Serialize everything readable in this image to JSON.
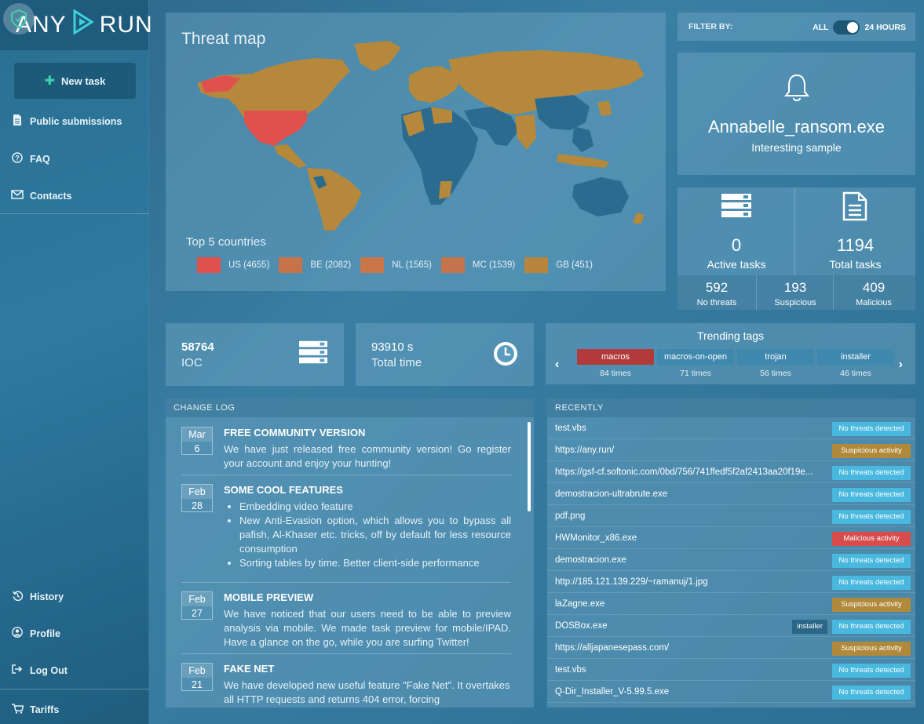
{
  "brand": {
    "logo_left": "ANY",
    "logo_right": "RUN"
  },
  "sidebar": {
    "new_task": "New task",
    "items": [
      {
        "label": "Public submissions",
        "icon": "file-icon"
      },
      {
        "label": "FAQ",
        "icon": "question-icon"
      },
      {
        "label": "Contacts",
        "icon": "mail-icon"
      }
    ],
    "bottom": [
      {
        "label": "History",
        "icon": "history-icon"
      },
      {
        "label": "Profile",
        "icon": "user-icon"
      },
      {
        "label": "Log Out",
        "icon": "logout-icon"
      },
      {
        "label": "Tariffs",
        "icon": "cart-icon"
      }
    ]
  },
  "threat_map": {
    "title": "Threat map",
    "top_label": "Top 5 countries",
    "countries": [
      {
        "label": "US (4655)",
        "color": "#e0504c"
      },
      {
        "label": "BE (2082)",
        "color": "#c8724a"
      },
      {
        "label": "NL (1565)",
        "color": "#c8764a"
      },
      {
        "label": "MC (1539)",
        "color": "#c4744a"
      },
      {
        "label": "GB (451)",
        "color": "#b8853c"
      }
    ]
  },
  "filter": {
    "label": "FILTER BY:",
    "left": "ALL",
    "right": "24 HOURS"
  },
  "sample": {
    "name": "Annabelle_ransom.exe",
    "sub": "Interesting sample"
  },
  "stats": {
    "active_num": "0",
    "active_label": "Active tasks",
    "total_num": "1194",
    "total_label": "Total tasks",
    "no_threats_num": "592",
    "no_threats_label": "No threats",
    "suspicious_num": "193",
    "suspicious_label": "Suspicious",
    "malicious_num": "409",
    "malicious_label": "Malicious"
  },
  "ioc": {
    "num": "58764",
    "label": "IOC"
  },
  "time": {
    "num": "93910 s",
    "label": "Total time"
  },
  "trending": {
    "title": "Trending tags",
    "tags": [
      {
        "name": "macros",
        "count": "84 times"
      },
      {
        "name": "macros-on-open",
        "count": "71 times"
      },
      {
        "name": "trojan",
        "count": "56 times"
      },
      {
        "name": "installer",
        "count": "46 times"
      }
    ]
  },
  "changelog": {
    "title": "CHANGE LOG",
    "items": [
      {
        "month": "Mar",
        "day": "6",
        "title": "FREE COMMUNITY VERSION",
        "text": "We have just released free community version! Go register your account and enjoy your hunting!"
      },
      {
        "month": "Feb",
        "day": "28",
        "title": "SOME COOL FEATURES",
        "bullets": [
          "Embedding video feature",
          "New Anti-Evasion option, which allows you to bypass all pafish, Al-Khaser etc. tricks, off by default for less resource consumption",
          "Sorting tables by time. Better client-side performance"
        ]
      },
      {
        "month": "Feb",
        "day": "27",
        "title": "MOBILE PREVIEW",
        "text": "We have noticed that our users need to be able to preview analysis via mobile. We made task preview for mobile/IPAD. Have a glance on the go, while you are surfing Twitter!"
      },
      {
        "month": "Feb",
        "day": "21",
        "title": "FAKE NET",
        "text": "We have developed new useful feature \"Fake Net\". It overtakes all HTTP requests and returns 404 error, forcing"
      }
    ]
  },
  "recently": {
    "title": "RECENTLY",
    "rows": [
      {
        "name": "test.vbs",
        "status": "No threats detected",
        "kind": "clean"
      },
      {
        "name": "https://any.run/",
        "status": "Suspicious activity",
        "kind": "sus"
      },
      {
        "name": "https://gsf-cf.softonic.com/0bd/756/741ffedf5f2af2413aa20f19e...",
        "status": "No threats detected",
        "kind": "clean"
      },
      {
        "name": "demostracion-ultrabrute.exe",
        "status": "No threats detected",
        "kind": "clean"
      },
      {
        "name": "pdf.png",
        "status": "No threats detected",
        "kind": "clean"
      },
      {
        "name": "HWMonitor_x86.exe",
        "status": "Malicious activity",
        "kind": "mal"
      },
      {
        "name": "demostracion.exe",
        "status": "No threats detected",
        "kind": "clean"
      },
      {
        "name": "http://185.121.139.229/~ramanuj/1.jpg",
        "status": "No threats detected",
        "kind": "clean"
      },
      {
        "name": "laZagne.exe",
        "status": "Suspicious activity",
        "kind": "sus"
      },
      {
        "name": "DOSBox.exe",
        "status": "No threats detected",
        "kind": "clean",
        "tag": "installer"
      },
      {
        "name": "https://alljapanesepass.com/",
        "status": "Suspicious activity",
        "kind": "sus"
      },
      {
        "name": "test.vbs",
        "status": "No threats detected",
        "kind": "clean"
      },
      {
        "name": "Q-Dir_Installer_V-5.99.5.exe",
        "status": "No threats detected",
        "kind": "clean"
      }
    ]
  }
}
